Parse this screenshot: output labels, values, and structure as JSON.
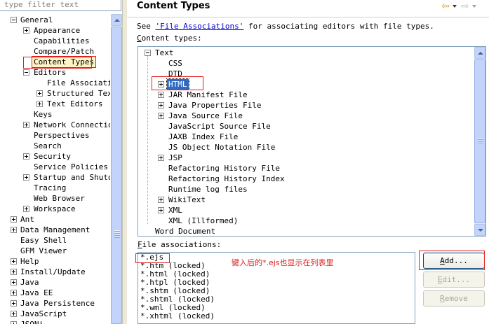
{
  "filter": {
    "placeholder": "type filter text"
  },
  "left_tree": [
    {
      "label": "General",
      "expander": "minus",
      "level": 0
    },
    {
      "label": "Appearance",
      "expander": "plus",
      "level": 1
    },
    {
      "label": "Capabilities",
      "expander": "none",
      "level": 1
    },
    {
      "label": "Compare/Patch",
      "expander": "none",
      "level": 1
    },
    {
      "label": "Content Types",
      "expander": "none",
      "level": 1,
      "selected": true
    },
    {
      "label": "Editors",
      "expander": "minus",
      "level": 1
    },
    {
      "label": "File Associatio",
      "expander": "none",
      "level": 2
    },
    {
      "label": "Structured Text",
      "expander": "plus",
      "level": 2
    },
    {
      "label": "Text Editors",
      "expander": "plus",
      "level": 2
    },
    {
      "label": "Keys",
      "expander": "none",
      "level": 1
    },
    {
      "label": "Network Connection",
      "expander": "plus",
      "level": 1
    },
    {
      "label": "Perspectives",
      "expander": "none",
      "level": 1
    },
    {
      "label": "Search",
      "expander": "none",
      "level": 1
    },
    {
      "label": "Security",
      "expander": "plus",
      "level": 1
    },
    {
      "label": "Service Policies",
      "expander": "none",
      "level": 1
    },
    {
      "label": "Startup and Shutdo",
      "expander": "plus",
      "level": 1
    },
    {
      "label": "Tracing",
      "expander": "none",
      "level": 1
    },
    {
      "label": "Web Browser",
      "expander": "none",
      "level": 1
    },
    {
      "label": "Workspace",
      "expander": "plus",
      "level": 1
    },
    {
      "label": "Ant",
      "expander": "plus",
      "level": 0
    },
    {
      "label": "Data Management",
      "expander": "plus",
      "level": 0
    },
    {
      "label": "Easy Shell",
      "expander": "none",
      "level": 0
    },
    {
      "label": "GFM Viewer",
      "expander": "none",
      "level": 0
    },
    {
      "label": "Help",
      "expander": "plus",
      "level": 0
    },
    {
      "label": "Install/Update",
      "expander": "plus",
      "level": 0
    },
    {
      "label": "Java",
      "expander": "plus",
      "level": 0
    },
    {
      "label": "Java EE",
      "expander": "plus",
      "level": 0
    },
    {
      "label": "Java Persistence",
      "expander": "plus",
      "level": 0
    },
    {
      "label": "JavaScript",
      "expander": "plus",
      "level": 0
    },
    {
      "label": "JSONi...",
      "expander": "plus",
      "level": 0
    }
  ],
  "header": {
    "title": "Content Types",
    "back_icon": "back-arrow-icon",
    "forward_icon": "forward-arrow-icon"
  },
  "see_line": {
    "prefix": "See ",
    "link": "'File Associations'",
    "suffix": " for associating editors with file types."
  },
  "content_types_label": {
    "first": "C",
    "rest": "ontent types:"
  },
  "content_types": [
    {
      "label": "Text",
      "expander": "minus",
      "level": 0
    },
    {
      "label": "CSS",
      "expander": "none",
      "level": 1
    },
    {
      "label": "DTD",
      "expander": "none",
      "level": 1
    },
    {
      "label": "HTML",
      "expander": "plus",
      "level": 1,
      "selected": true
    },
    {
      "label": "JAR Manifest File",
      "expander": "plus",
      "level": 1
    },
    {
      "label": "Java Properties File",
      "expander": "plus",
      "level": 1
    },
    {
      "label": "Java Source File",
      "expander": "plus",
      "level": 1
    },
    {
      "label": "JavaScript Source File",
      "expander": "none",
      "level": 1
    },
    {
      "label": "JAXB Index File",
      "expander": "none",
      "level": 1
    },
    {
      "label": "JS Object Notation File",
      "expander": "none",
      "level": 1
    },
    {
      "label": "JSP",
      "expander": "plus",
      "level": 1
    },
    {
      "label": "Refactoring History File",
      "expander": "none",
      "level": 1
    },
    {
      "label": "Refactoring History Index",
      "expander": "none",
      "level": 1
    },
    {
      "label": "Runtime log files",
      "expander": "none",
      "level": 1
    },
    {
      "label": "WikiText",
      "expander": "plus",
      "level": 1
    },
    {
      "label": "XML",
      "expander": "plus",
      "level": 1
    },
    {
      "label": "XML (Illformed)",
      "expander": "none",
      "level": 1
    },
    {
      "label": "Word Document",
      "expander": "none",
      "level": 0
    }
  ],
  "file_assoc_label": {
    "first": "F",
    "rest": "ile associations:"
  },
  "file_associations": [
    "*.ejs",
    "*.htm (locked)",
    "*.html (locked)",
    "*.htpl (locked)",
    "*.shtm (locked)",
    "*.shtml (locked)",
    "*.wml (locked)",
    "*.xhtml (locked)"
  ],
  "annotation": "键入后的*.ejs也显示在列表里",
  "buttons": {
    "add": {
      "first": "A",
      "rest": "dd..."
    },
    "edit": {
      "first": "E",
      "rest": "dit..."
    },
    "remove": {
      "first": "R",
      "rest": "emove"
    }
  },
  "colors": {
    "annotation_red": "#e02020",
    "link_blue": "#0000cc",
    "selection_bg": "#316ac5"
  }
}
